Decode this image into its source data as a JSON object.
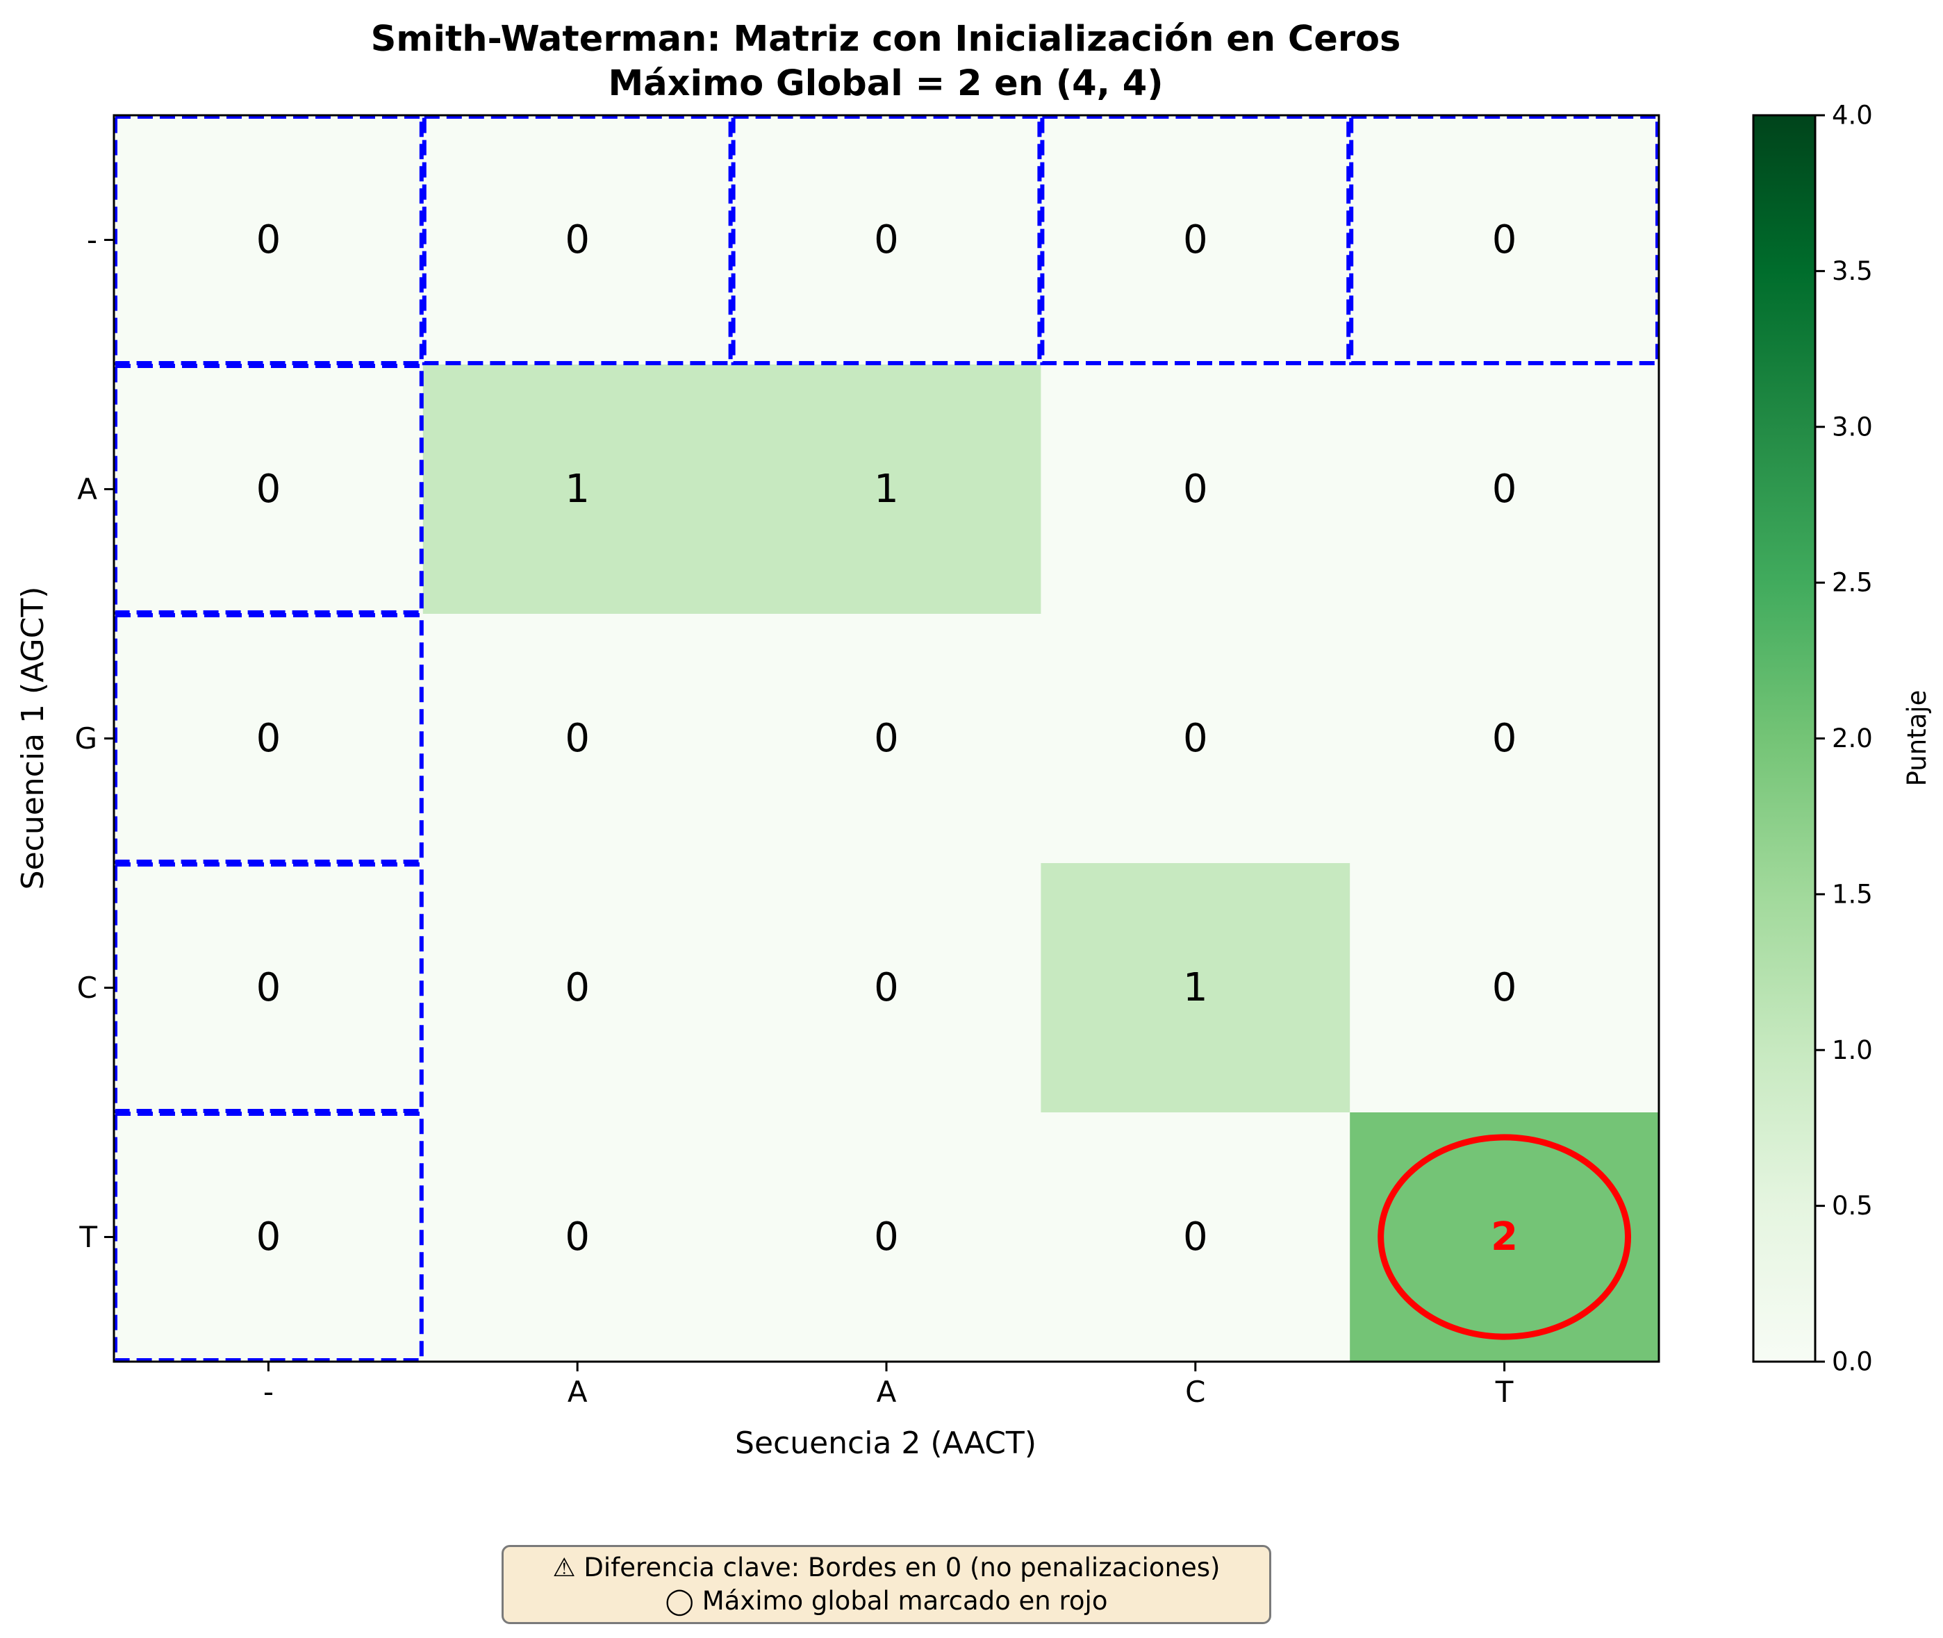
{
  "chart_data": {
    "type": "heatmap",
    "title": "Smith-Waterman: Matriz con Inicialización en Ceros",
    "subtitle": "Máximo Global = 2 en (4, 4)",
    "xlabel": "Secuencia 2 (AACT)",
    "ylabel": "Secuencia 1 (AGCT)",
    "x_categories": [
      "-",
      "A",
      "A",
      "C",
      "T"
    ],
    "y_categories": [
      "-",
      "A",
      "G",
      "C",
      "T"
    ],
    "values": [
      [
        0,
        0,
        0,
        0,
        0
      ],
      [
        0,
        1,
        1,
        0,
        0
      ],
      [
        0,
        0,
        0,
        0,
        0
      ],
      [
        0,
        0,
        0,
        1,
        0
      ],
      [
        0,
        0,
        0,
        0,
        2
      ]
    ],
    "max": {
      "row": 4,
      "col": 4,
      "value": 2,
      "color": "#ff0000"
    },
    "colorbar": {
      "label": "Puntaje",
      "range": [
        0,
        4
      ],
      "ticks": [
        "0.0",
        "0.5",
        "1.0",
        "1.5",
        "2.0",
        "2.5",
        "3.0",
        "3.5",
        "4.0"
      ],
      "colormap": "Greens"
    },
    "border_highlight_color": "#0000ff"
  },
  "note": {
    "line1": "⚠ Diferencia clave: Bordes en 0 (no penalizaciones)",
    "line2": "◯ Máximo global marcado en rojo"
  }
}
